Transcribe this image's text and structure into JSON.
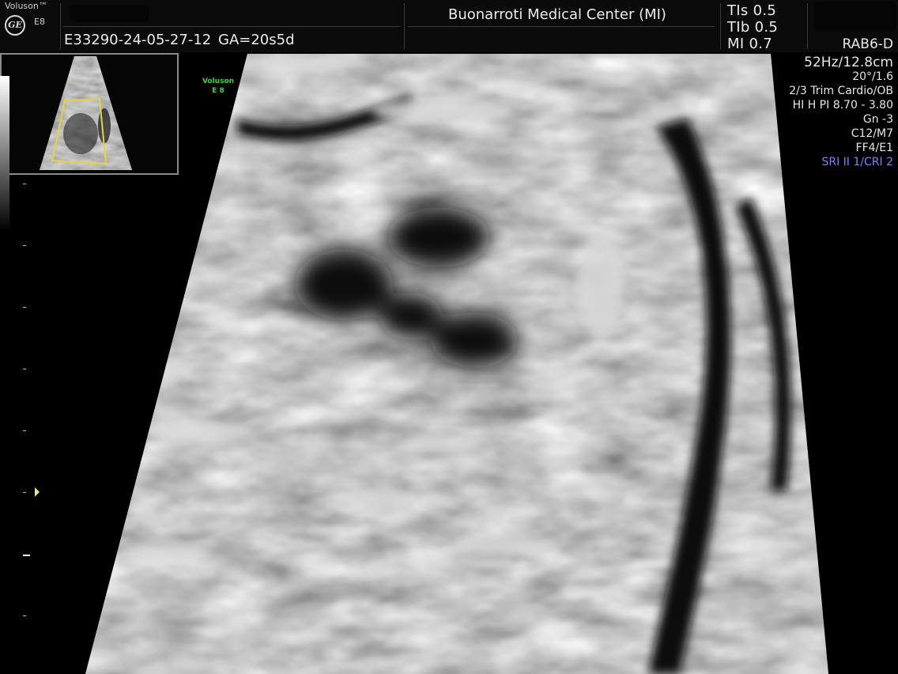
{
  "header": {
    "brand": "Voluson™",
    "brand_model": "E8",
    "patient_id": "E33290-24-05-27-12",
    "gestational_age": "GA=20s5d",
    "institution": "Buonarroti Medical Center (MI)",
    "safety": {
      "tis": "TIs  0.5",
      "tib": "TIb  0.5",
      "mi": "MI  0.7"
    },
    "probe": "RAB6-D"
  },
  "params": {
    "frame_depth": "52Hz/12.8cm",
    "angle_quality": "20°/1.6",
    "preset": "2/3 Trim Cardio/OB",
    "harmonic": "HI H PI 8.70 - 3.80",
    "gain": "Gn  -3",
    "compound": "C12/M7",
    "filter": "FF4/E1",
    "sri": "SRI II 1/CRI 2"
  },
  "thumbnail": {
    "mark_brand": "Voluson",
    "mark_model": "E 8"
  },
  "colors": {
    "sri_text": "#7b84ff",
    "thumbnail_roi_box": "#e6d23c",
    "focus_marker": "#f2e28c",
    "mark_green": "#39d33b"
  },
  "icons": {
    "logo": "ge-logo-icon",
    "focus": "focus-marker-icon"
  }
}
